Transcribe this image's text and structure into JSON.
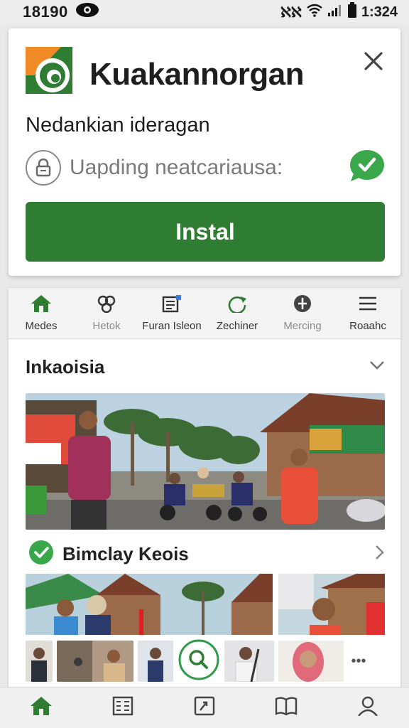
{
  "status_bar": {
    "time_left": "18190",
    "time_right": "1:324",
    "carrier_glyph": "ℵℵ"
  },
  "banner": {
    "app_name": "Kuakannorgan",
    "subtitle": "Nedankian ideragan",
    "secure_text": "Uapding neatcariausa:",
    "install_label": "Instal",
    "icons": {
      "logo": "app-logo-icon",
      "close": "close-icon",
      "lock": "lock-icon",
      "check": "whatsapp-check-icon"
    },
    "colors": {
      "accent": "#2e7d32",
      "logo_orange": "#f08a24"
    }
  },
  "tabs": [
    {
      "label": "Medes",
      "icon": "home-icon",
      "active": true
    },
    {
      "label": "Hetok",
      "icon": "group-icon",
      "active": false
    },
    {
      "label": "Furan Isleon",
      "icon": "news-icon",
      "active": false
    },
    {
      "label": "Zechiner",
      "icon": "refresh-icon",
      "active": false
    },
    {
      "label": "Mercing",
      "icon": "compass-icon",
      "active": false
    },
    {
      "label": "Roaahc",
      "icon": "menu-icon",
      "active": false
    }
  ],
  "section": {
    "title": "Inkaoisia"
  },
  "row": {
    "title": "Bimclay Keois"
  },
  "more_label": "•••",
  "bottom_nav": [
    {
      "name": "home",
      "icon": "home-icon"
    },
    {
      "name": "list",
      "icon": "list-icon"
    },
    {
      "name": "share",
      "icon": "share-box-icon"
    },
    {
      "name": "book",
      "icon": "book-icon"
    },
    {
      "name": "profile",
      "icon": "person-icon"
    }
  ]
}
